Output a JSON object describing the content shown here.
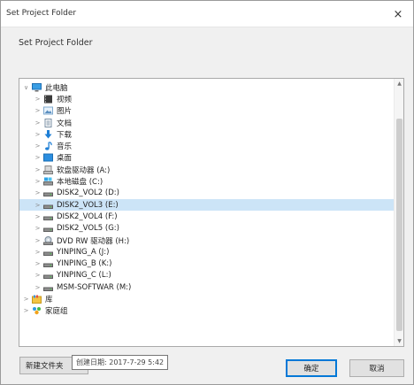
{
  "dialog": {
    "title": "Set Project Folder",
    "close_glyph": "×",
    "instruction": "Set Project Folder"
  },
  "tree": {
    "items": [
      {
        "level": 0,
        "expanded": true,
        "icon": "computer-icon",
        "label": "此电脑"
      },
      {
        "level": 1,
        "expanded": false,
        "icon": "videos-folder-icon",
        "label": "视频"
      },
      {
        "level": 1,
        "expanded": false,
        "icon": "pictures-folder-icon",
        "label": "图片"
      },
      {
        "level": 1,
        "expanded": false,
        "icon": "documents-folder-icon",
        "label": "文档"
      },
      {
        "level": 1,
        "expanded": false,
        "icon": "downloads-folder-icon",
        "label": "下载"
      },
      {
        "level": 1,
        "expanded": false,
        "icon": "music-folder-icon",
        "label": "音乐"
      },
      {
        "level": 1,
        "expanded": false,
        "icon": "desktop-folder-icon",
        "label": "桌面"
      },
      {
        "level": 1,
        "expanded": false,
        "icon": "floppy-drive-icon",
        "label": "软盘驱动器 (A:)"
      },
      {
        "level": 1,
        "expanded": false,
        "icon": "system-drive-icon",
        "label": "本地磁盘 (C:)"
      },
      {
        "level": 1,
        "expanded": false,
        "icon": "drive-icon",
        "label": "DISK2_VOL2 (D:)"
      },
      {
        "level": 1,
        "expanded": false,
        "icon": "drive-icon",
        "label": "DISK2_VOL3 (E:)",
        "selected": true
      },
      {
        "level": 1,
        "expanded": false,
        "icon": "drive-icon",
        "label": "DISK2_VOL4 (F:)"
      },
      {
        "level": 1,
        "expanded": false,
        "icon": "drive-icon",
        "label": "DISK2_VOL5 (G:)"
      },
      {
        "level": 1,
        "expanded": false,
        "icon": "dvd-drive-icon",
        "label": "DVD RW 驱动器 (H:)"
      },
      {
        "level": 1,
        "expanded": false,
        "icon": "drive-icon",
        "label": "YINPING_A (J:)"
      },
      {
        "level": 1,
        "expanded": false,
        "icon": "drive-icon",
        "label": "YINPING_B (K:)"
      },
      {
        "level": 1,
        "expanded": false,
        "icon": "drive-icon",
        "label": "YINPING_C (L:)"
      },
      {
        "level": 1,
        "expanded": false,
        "icon": "drive-icon",
        "label": "MSM-SOFTWAR (M:)"
      },
      {
        "level": 0,
        "expanded": false,
        "icon": "library-icon",
        "label": "库"
      },
      {
        "level": 0,
        "expanded": false,
        "icon": "homegroup-icon",
        "label": "家庭组"
      }
    ]
  },
  "buttons": {
    "new_folder": "新建文件夹",
    "ok": "确定",
    "cancel": "取消"
  },
  "tooltip": "创建日期: 2017-7-29 5:42",
  "colors": {
    "selection": "#cce4f7",
    "accent": "#0078d7"
  }
}
